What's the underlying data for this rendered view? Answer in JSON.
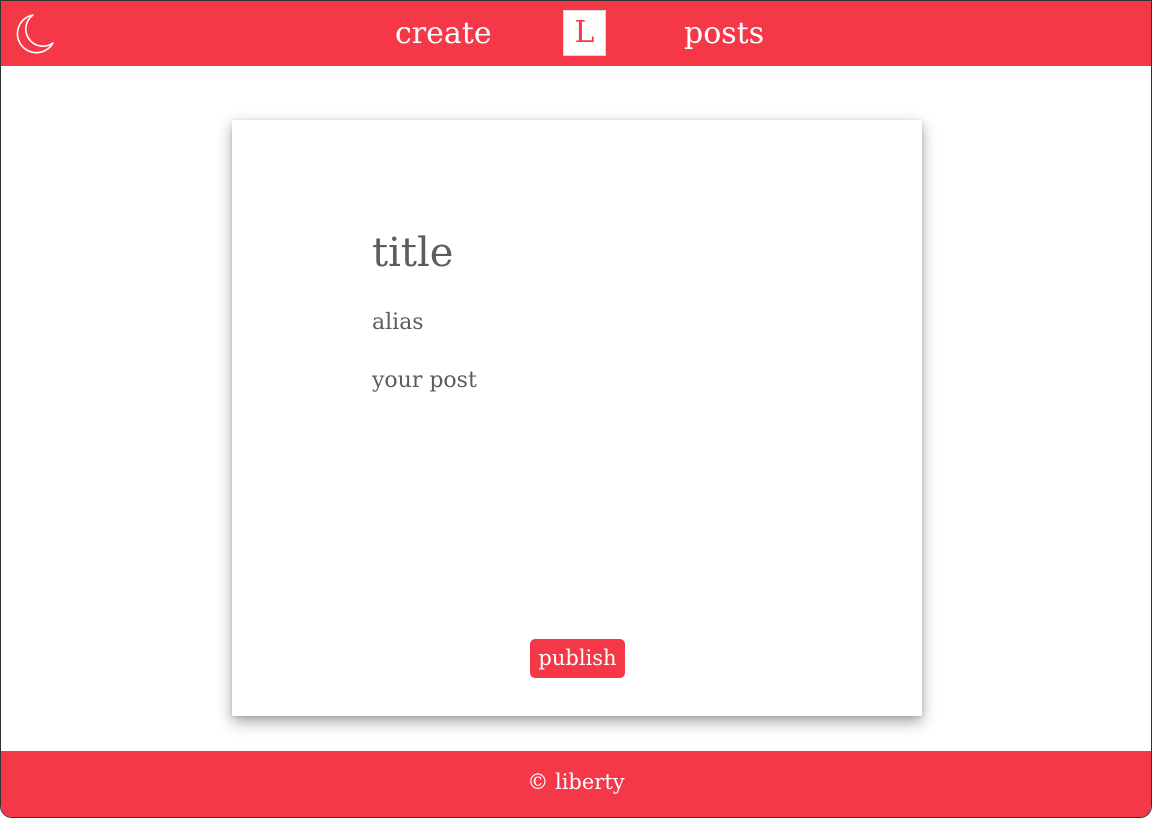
{
  "navbar": {
    "theme_toggle_icon": "moon-icon",
    "create_label": "create",
    "logo_letter": "L",
    "posts_label": "posts"
  },
  "editor": {
    "title_placeholder": "title",
    "alias_placeholder": "alias",
    "post_placeholder": "your post",
    "publish_label": "publish"
  },
  "footer": {
    "copyright": "© liberty"
  },
  "colors": {
    "brand": "#f43848",
    "placeholder_text": "#5d5d5d",
    "background": "#ffffff"
  }
}
